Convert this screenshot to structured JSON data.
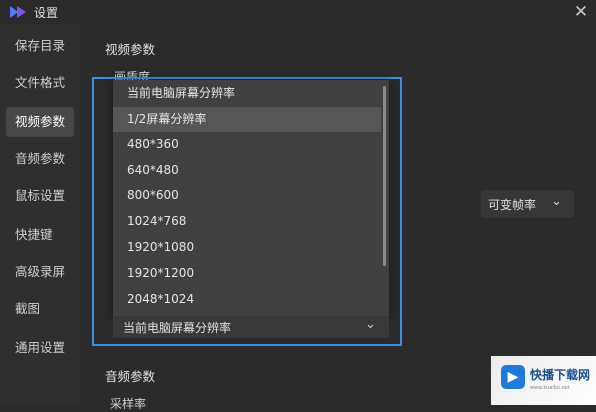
{
  "window": {
    "title": "设置",
    "close_glyph": "✕"
  },
  "sidebar": {
    "items": [
      {
        "label": "保存目录"
      },
      {
        "label": "文件格式"
      },
      {
        "label": "视频参数",
        "active": true
      },
      {
        "label": "音频参数"
      },
      {
        "label": "鼠标设置"
      },
      {
        "label": "快捷键"
      },
      {
        "label": "高级录屏"
      },
      {
        "label": "截图"
      },
      {
        "label": "通用设置"
      }
    ]
  },
  "main": {
    "video_section_title": "视频参数",
    "resolution_label": "画质度",
    "framerate": {
      "value": "可变帧率"
    },
    "resolution": {
      "selected": "当前电脑屏幕分辨率",
      "options": [
        "当前电脑屏幕分辨率",
        "1/2屏幕分辨率",
        "480*360",
        "640*480",
        "800*600",
        "1024*768",
        "1920*1080",
        "1920*1200",
        "2048*1024"
      ],
      "hovered_index": 1
    },
    "audio_section_title": "音频参数",
    "samplerate_label": "采样率"
  },
  "watermark": {
    "title": "快播下载网",
    "url": "www.kuaibo.net"
  },
  "colors": {
    "accent": "#3c8ee3",
    "background": "#2b2b2b",
    "sidebar_active": "#474747",
    "dropdown_bg": "#404040"
  },
  "icons": {
    "app_logo": "app-logo-icon",
    "close": "close-icon",
    "chevron": "chevron-down-icon"
  }
}
